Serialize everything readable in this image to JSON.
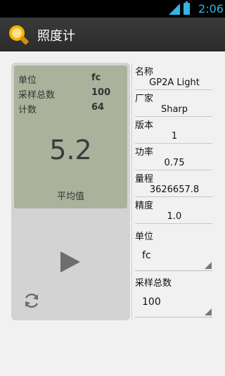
{
  "status_bar": {
    "time": "2:06"
  },
  "app_bar": {
    "title": "照度计"
  },
  "lcd": {
    "rows": [
      {
        "label": "单位",
        "value": "fc"
      },
      {
        "label": "采样总数",
        "value": "100"
      },
      {
        "label": "计数",
        "value": "64"
      }
    ],
    "reading": "5.2",
    "caption": "平均值"
  },
  "info": {
    "name_label": "名称",
    "name_value": "GP2A Light",
    "vendor_label": "厂家",
    "vendor_value": "Sharp",
    "version_label": "版本",
    "version_value": "1",
    "power_label": "功率",
    "power_value": "0.75",
    "range_label": "量程",
    "range_value": "3626657.8",
    "precision_label": "精度",
    "precision_value": "1.0",
    "unit_label": "单位",
    "unit_selected": "fc",
    "samples_label": "采样总数",
    "samples_selected": "100"
  },
  "colors": {
    "lcd_background": "#aab29c",
    "panel_background": "#d3d3d3",
    "accent": "#33b5e5"
  },
  "icons": [
    "signal-icon",
    "battery-icon",
    "light-bulb-icon",
    "play-icon",
    "refresh-icon",
    "spinner-arrow-icon"
  ]
}
